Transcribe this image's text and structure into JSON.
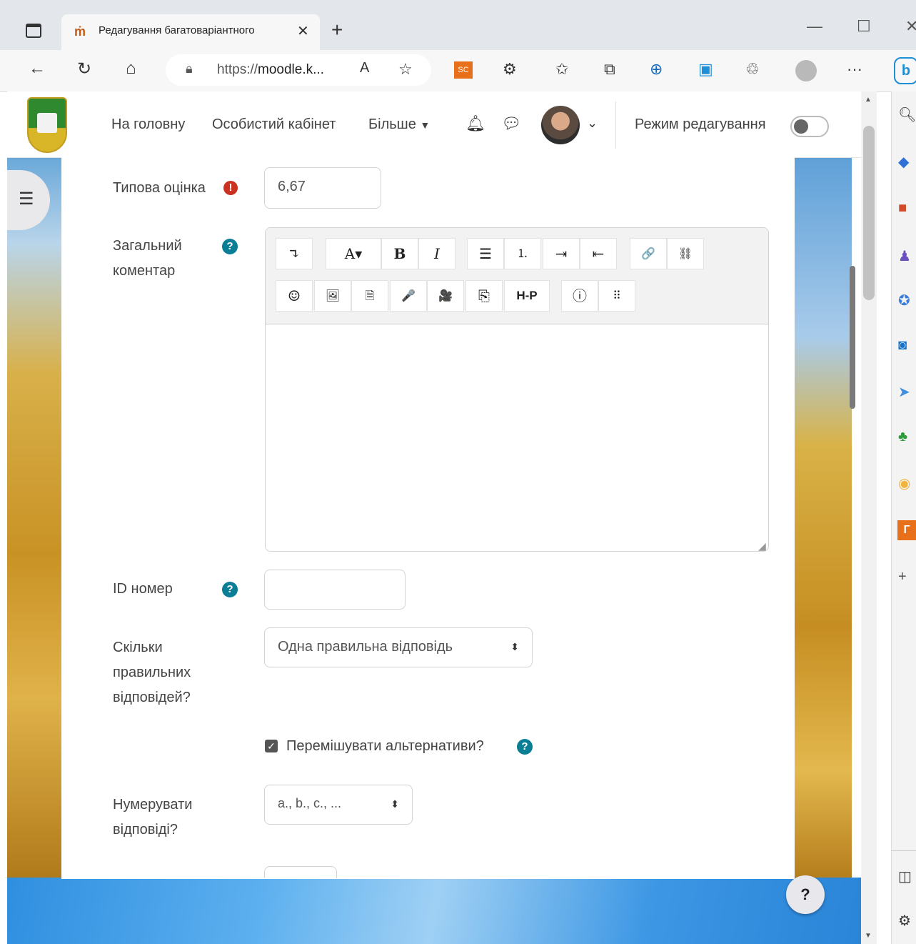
{
  "browser": {
    "tab_title": "Редагування багатоваріантного",
    "tab_favicon": "ṁ",
    "tab_close": "✕",
    "new_tab": "+",
    "url_prefix": "https://",
    "url_host": "moodle.k...",
    "read_aloud": "A",
    "window_controls": {
      "minimize": "—",
      "maximize": "☐",
      "close": "✕"
    },
    "toolbar_icons": [
      "back-icon",
      "refresh-icon",
      "home-icon",
      "read-aloud-icon",
      "favorite-add-icon",
      "sc-extension-icon",
      "extensions-icon",
      "favorites-icon",
      "collections-icon",
      "downloads-icon",
      "ie-mode-icon",
      "performance-icon",
      "profile-icon",
      "more-icon",
      "bing-icon"
    ],
    "sc_badge": "SC",
    "more": "···"
  },
  "header": {
    "nav_home": "На головну",
    "nav_dashboard": "Особистий кабінет",
    "nav_more": "Більше",
    "edit_mode_label": "Режим редагування",
    "edit_mode_on": false
  },
  "form": {
    "default_mark_label": "Типова оцінка",
    "default_mark_value": "6,67",
    "general_feedback_label": "Загальний коментар",
    "id_number_label": "ID номер",
    "id_number_value": "",
    "how_many_label": "Скільки правильних відповідей?",
    "how_many_value": "Одна правильна відповідь",
    "shuffle_label": "Перемішувати альтернативи?",
    "shuffle_checked": true,
    "numbering_label": "Нумерувати відповіді?",
    "numbering_value": "a., b., c., ..."
  },
  "editor_toolbar": {
    "row1": [
      "↴",
      "A▾",
      "B",
      "I",
      "☰",
      "⒈",
      "⇥",
      "⇤",
      "🔗",
      "⛓"
    ],
    "row2": [
      "☺",
      "🖼",
      "🗎",
      "🎤",
      "🎥",
      "⎘",
      "H-P",
      "ⓘ",
      "⠿"
    ],
    "h5p_label": "H-P",
    "bold_label": "B",
    "italic_label": "I",
    "font_label": "A▾"
  },
  "help_button": "?",
  "sidebar_right_icons": [
    "search-icon",
    "tag-icon",
    "briefcase-icon",
    "people-icon",
    "office-icon",
    "outlook-icon",
    "send-icon",
    "tree-icon",
    "circle-icon",
    "g-icon",
    "add-icon",
    "split-icon",
    "settings-icon"
  ],
  "colors": {
    "link_blue": "#0f6cbf",
    "required_red": "#ca3120",
    "help_teal": "#0a7e94"
  }
}
